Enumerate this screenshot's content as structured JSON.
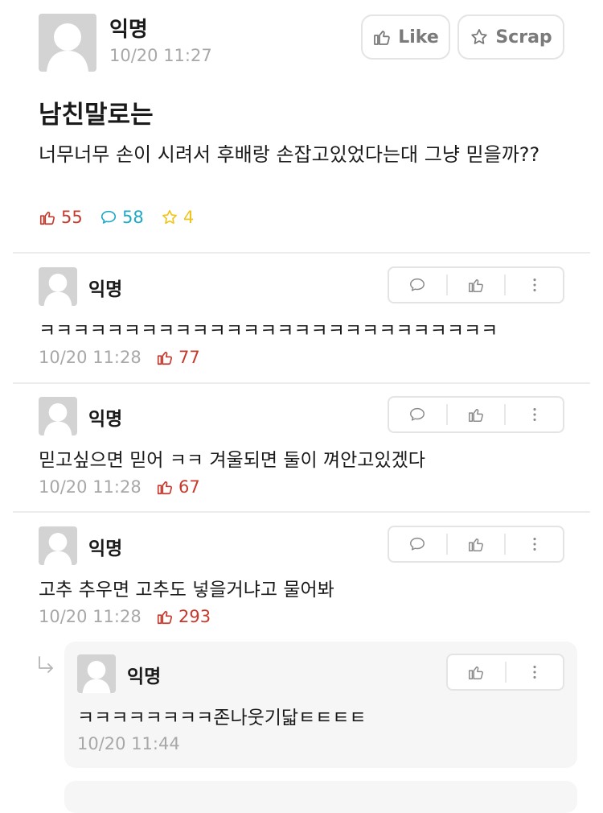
{
  "post": {
    "author": "익명",
    "time": "10/20 11:27",
    "like_label": "Like",
    "scrap_label": "Scrap",
    "title": "남친말로는",
    "body": "너무너무 손이 시려서 후배랑 손잡고있었다는대 그냥 믿을까??",
    "stats": {
      "likes": "55",
      "comments": "58",
      "scraps": "4"
    }
  },
  "comments": [
    {
      "author": "익명",
      "text": "ㅋㅋㅋㅋㅋㅋㅋㅋㅋㅋㅋㅋㅋㅋㅋㅋㅋㅋㅋㅋㅋㅋㅋㅋㅋㅋㅋ",
      "time": "10/20 11:28",
      "votes": "77"
    },
    {
      "author": "익명",
      "text": "믿고싶으면 믿어 ㅋㅋ 겨울되면 둘이 껴안고있겠다",
      "time": "10/20 11:28",
      "votes": "67"
    },
    {
      "author": "익명",
      "text": "고추 추우면 고추도 넣을거냐고 물어봐",
      "time": "10/20 11:28",
      "votes": "293"
    }
  ],
  "replies": [
    {
      "author": "익명",
      "text": "ㅋㅋㅋㅋㅋㅋㅋㅋ존나웃기닯ㅌㅌㅌㅌ",
      "time": "10/20 11:44"
    }
  ],
  "colors": {
    "like_red": "#c6392c",
    "comment_cyan": "#1fa9c4",
    "scrap_yellow": "#f0c419",
    "muted": "#a8a8a8"
  },
  "icons": {
    "thumb": "thumbs-up-icon",
    "comment": "speech-bubble-icon",
    "star": "star-icon",
    "more": "vertical-dots-icon",
    "reply": "reply-arrow-icon"
  }
}
